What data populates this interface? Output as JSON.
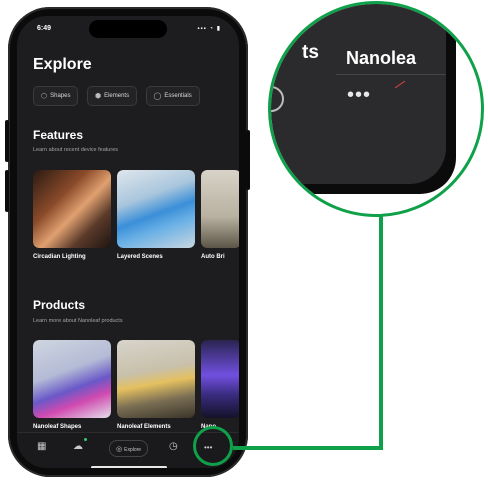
{
  "status": {
    "time": "6:49",
    "signal": "▪▪▪ ◔ ▮"
  },
  "page": {
    "title": "Explore"
  },
  "pills": [
    {
      "icon": "shapes-icon",
      "glyph": "⬡",
      "label": "Shapes"
    },
    {
      "icon": "elements-icon",
      "glyph": "⬢",
      "label": "Elements"
    },
    {
      "icon": "bulb-icon",
      "glyph": "◯",
      "label": "Essentials"
    }
  ],
  "features": {
    "title": "Features",
    "subtitle": "Learn about recent device features",
    "cards": [
      {
        "label": "Circadian Lighting"
      },
      {
        "label": "Layered Scenes"
      },
      {
        "label": "Auto Bri"
      }
    ]
  },
  "products": {
    "title": "Products",
    "subtitle": "Learn more about Nanoleaf products",
    "cards": [
      {
        "label": "Nanoleaf Shapes"
      },
      {
        "label": "Nanoleaf Elements"
      },
      {
        "label": "Nano"
      }
    ]
  },
  "tabbar": {
    "items": [
      {
        "glyph": "▦"
      },
      {
        "glyph": "☁"
      },
      {
        "glyph": "◎",
        "label": "Explore"
      },
      {
        "glyph": "◷"
      },
      {
        "glyph": "•••"
      }
    ]
  },
  "zoom": {
    "fragment": "ts",
    "word": "Nanolea",
    "dots": "•••"
  }
}
